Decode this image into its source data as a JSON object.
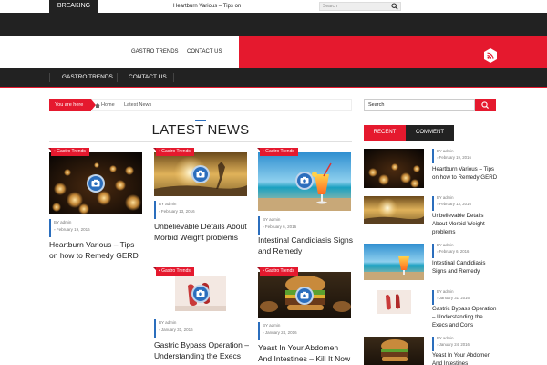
{
  "topbar": {
    "breaking_label": "BREAKING",
    "ticker_text": "Heartburn Various – Tips on",
    "search_placeholder": "Search"
  },
  "header": {
    "links": [
      "GASTRO TRENDS",
      "CONTACT US"
    ]
  },
  "nav": {
    "items": [
      "GASTRO TRENDS",
      "CONTACT US"
    ]
  },
  "breadcrumb": {
    "label": "You are here",
    "home": "Home",
    "current": "Latest News"
  },
  "main": {
    "section_title": "LATEST NEWS",
    "posts": [
      {
        "category": "Gastro Trends",
        "author": "BY admin",
        "date": "February 19, 2016",
        "title": "Heartburn Various – Tips on how to Remedy GERD"
      },
      {
        "category": "Gastro Trends",
        "author": "BY admin",
        "date": "February 13, 2016",
        "title": "Unbelievable Details About Morbid Weight problems"
      },
      {
        "category": "Gastro Trends",
        "author": "BY admin",
        "date": "February 6, 2016",
        "title": "Intestinal Candidiasis Signs and Remedy"
      },
      {
        "category": "Gastro Trends",
        "author": "BY admin",
        "date": "January 31, 2016",
        "title": "Gastric Bypass Operation – Understanding the Execs"
      },
      {
        "category": "Gastro Trends",
        "author": "BY admin",
        "date": "January 24, 2016",
        "title": "Yeast In Your Abdomen And Intestines – Kill It Now"
      }
    ]
  },
  "sidebar": {
    "search_placeholder": "Search",
    "tabs": [
      "RECENT",
      "COMMENT"
    ],
    "items": [
      {
        "author": "BY admin",
        "date": "February 19, 2016",
        "title": "Heartburn Various – Tips on how to Remedy GERD"
      },
      {
        "author": "BY admin",
        "date": "February 13, 2016",
        "title": "Unbelievable Details About Morbid Weight problems"
      },
      {
        "author": "BY admin",
        "date": "February 6, 2016",
        "title": "Intestinal Candidiasis Signs and Remedy"
      },
      {
        "author": "BY admin",
        "date": "January 31, 2016",
        "title": "Gastric Bypass Operation – Understanding the Execs and Cons"
      },
      {
        "author": "BY admin",
        "date": "January 24, 2016",
        "title": "Yeast In Your Abdomen And Intestines"
      }
    ]
  },
  "colors": {
    "accent": "#e5192e",
    "dark": "#222222",
    "blue": "#2b6ebd"
  }
}
